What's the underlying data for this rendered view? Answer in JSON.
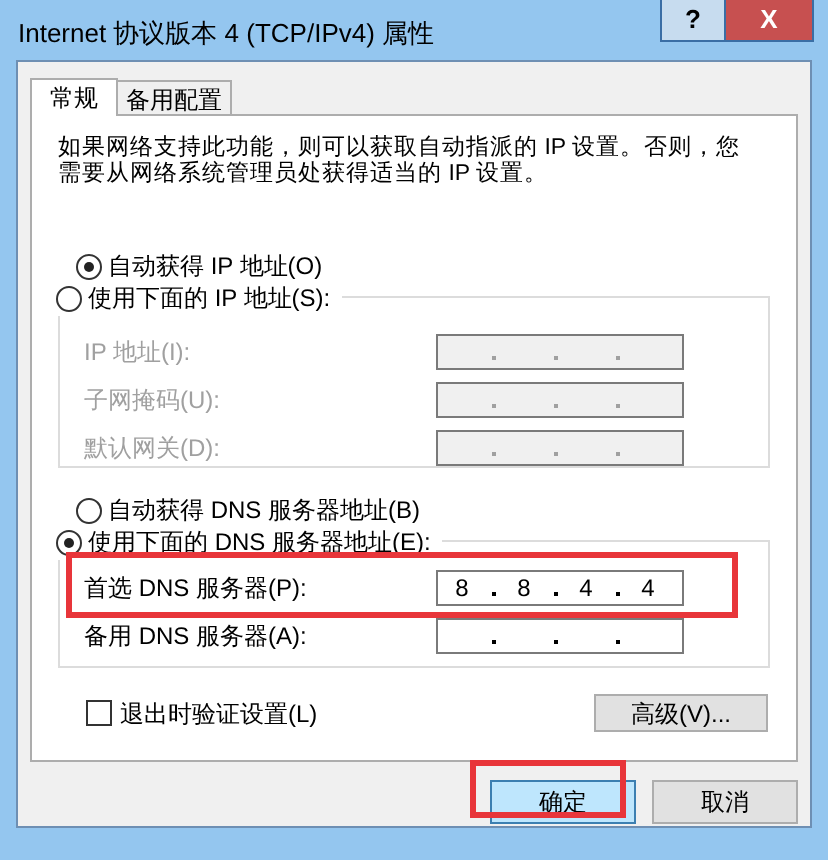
{
  "window": {
    "title": "Internet 协议版本 4 (TCP/IPv4) 属性",
    "help_button": "?",
    "close_button": "X"
  },
  "tabs": [
    {
      "label": "常规",
      "selected": true
    },
    {
      "label": "备用配置",
      "selected": false
    }
  ],
  "description": "如果网络支持此功能，则可以获取自动指派的 IP 设置。否则，您需要从网络系统管理员处获得适当的 IP 设置。",
  "ip_mode": [
    {
      "label": "自动获得 IP 地址(O)",
      "selected": true
    },
    {
      "label": "使用下面的 IP 地址(S):",
      "selected": false
    }
  ],
  "ip_fields": [
    {
      "label": "IP 地址(I):",
      "disabled": true
    },
    {
      "label": "子网掩码(U):",
      "disabled": true
    },
    {
      "label": "默认网关(D):",
      "disabled": true
    }
  ],
  "dns_mode": [
    {
      "label": "自动获得 DNS 服务器地址(B)",
      "selected": false
    },
    {
      "label": "使用下面的 DNS 服务器地址(E):",
      "selected": true
    }
  ],
  "dns_fields": [
    {
      "label": "首选 DNS 服务器(P):",
      "octets": [
        "8",
        "8",
        "4",
        "4"
      ],
      "disabled": false,
      "highlighted": true
    },
    {
      "label": "备用 DNS 服务器(A):",
      "disabled": false,
      "highlighted": false
    }
  ],
  "validate_on_exit": {
    "label": "退出时验证设置(L)",
    "checked": false
  },
  "advanced_button": "高级(V)...",
  "buttons": [
    {
      "label": "确定",
      "highlighted": true,
      "default": true
    },
    {
      "label": "取消",
      "highlighted": false,
      "default": false
    }
  ]
}
